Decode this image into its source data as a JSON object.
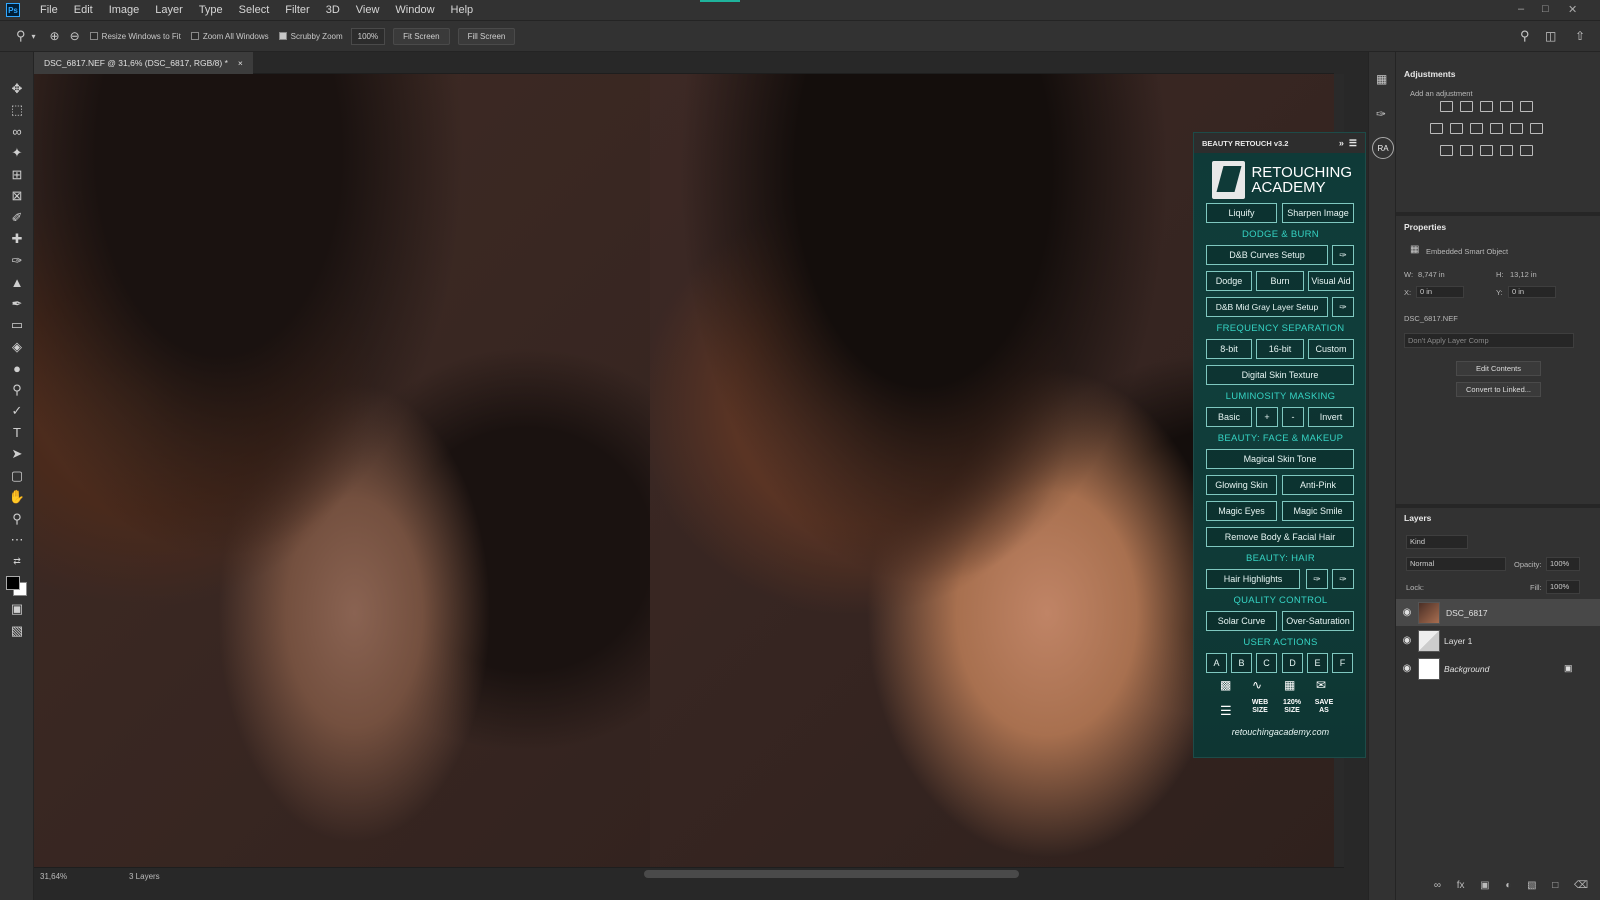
{
  "menubar": {
    "logo": "Ps",
    "items": [
      "File",
      "Edit",
      "Image",
      "Layer",
      "Type",
      "Select",
      "Filter",
      "3D",
      "View",
      "Window",
      "Help"
    ]
  },
  "options": {
    "resize_windows": "Resize Windows to Fit",
    "zoom_all": "Zoom All Windows",
    "scrubby_zoom": "Scrubby Zoom",
    "zoom_value": "100%",
    "fit_screen": "Fit Screen",
    "fill_screen": "Fill Screen"
  },
  "document": {
    "tab_title": "DSC_6817.NEF @ 31,6% (DSC_6817, RGB/8) *",
    "close": "×"
  },
  "status": {
    "zoom": "31,64%",
    "layers": "3 Layers"
  },
  "plugin": {
    "title": "BEAUTY RETOUCH v3.2",
    "logo_line1": "RETOUCHING",
    "logo_line2": "ACADEMY",
    "liquify": "Liquify",
    "sharpen": "Sharpen Image",
    "sec_db": "DODGE & BURN",
    "db_curves": "D&B Curves Setup",
    "dodge": "Dodge",
    "burn": "Burn",
    "visual_aid": "Visual Aid",
    "db_midgray": "D&B Mid Gray Layer Setup",
    "sec_fs": "FREQUENCY SEPARATION",
    "fs_8bit": "8-bit",
    "fs_16bit": "16-bit",
    "fs_custom": "Custom",
    "digital_skin": "Digital Skin Texture",
    "sec_lum": "LUMINOSITY MASKING",
    "lum_basic": "Basic",
    "lum_plus": "+",
    "lum_minus": "-",
    "lum_invert": "Invert",
    "sec_face": "BEAUTY: FACE & MAKEUP",
    "magical_skin": "Magical Skin Tone",
    "glowing_skin": "Glowing Skin",
    "anti_pink": "Anti-Pink",
    "magic_eyes": "Magic Eyes",
    "magic_smile": "Magic Smile",
    "remove_hair": "Remove Body & Facial Hair",
    "sec_hair": "BEAUTY: HAIR",
    "hair_highlights": "Hair Highlights",
    "sec_qc": "QUALITY CONTROL",
    "solar_curve": "Solar Curve",
    "over_saturation": "Over-Saturation",
    "sec_user": "USER ACTIONS",
    "user_actions": [
      "A",
      "B",
      "C",
      "D",
      "E",
      "F"
    ],
    "web_size": "WEB SIZE",
    "size_120": "120% SIZE",
    "save_as": "SAVE AS",
    "url": "retouchingacademy.com"
  },
  "dock": {
    "ra": "RA"
  },
  "adjustments": {
    "title": "Adjustments",
    "subtitle": "Add an adjustment"
  },
  "properties": {
    "title": "Properties",
    "type": "Embedded Smart Object",
    "w_label": "W:",
    "w_value": "8,747 in",
    "h_label": "H:",
    "h_value": "13,12 in",
    "x_label": "X:",
    "x_value": "0 in",
    "y_label": "Y:",
    "y_value": "0 in",
    "filename": "DSC_6817.NEF",
    "layer_comp": "Don't Apply Layer Comp",
    "edit_contents": "Edit Contents",
    "convert_linked": "Convert to Linked..."
  },
  "layers": {
    "title": "Layers",
    "kind": "Kind",
    "blend": "Normal",
    "opacity_label": "Opacity:",
    "opacity_value": "100%",
    "lock_label": "Lock:",
    "fill_label": "Fill:",
    "fill_value": "100%",
    "rows": [
      {
        "name": "DSC_6817"
      },
      {
        "name": "Layer 1"
      },
      {
        "name": "Background"
      }
    ]
  },
  "icons": {
    "zoom": "magnifier-icon",
    "eye": "eye-icon",
    "lock": "lock-icon"
  }
}
